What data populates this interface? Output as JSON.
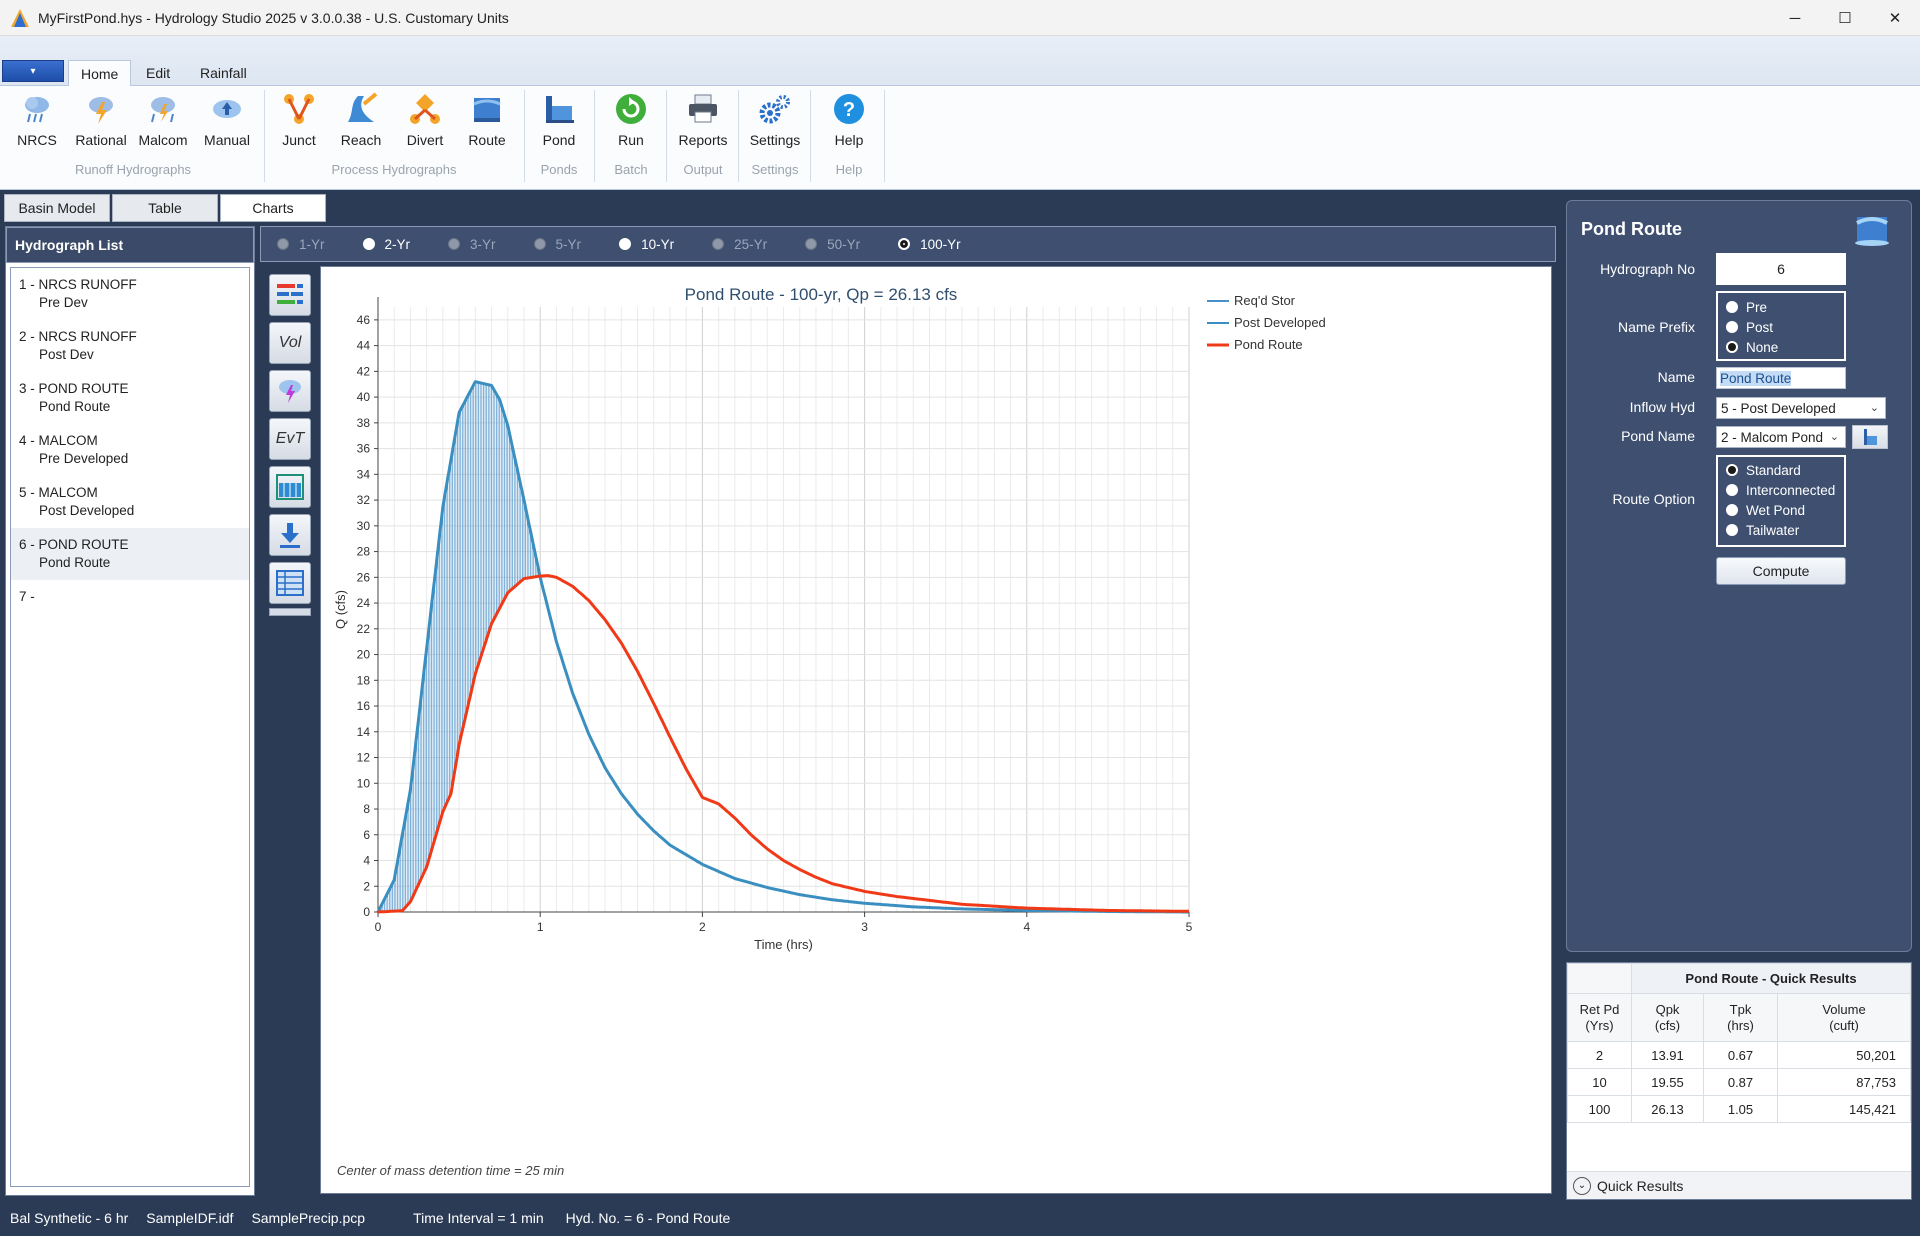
{
  "window": {
    "title": "MyFirstPond.hys - Hydrology Studio 2025 v 3.0.0.38 - U.S. Customary Units",
    "minimize": "─",
    "maximize": "☐",
    "close": "✕"
  },
  "ribbon": {
    "app_menu": "▾",
    "tabs": [
      {
        "label": "Home"
      },
      {
        "label": "Edit"
      },
      {
        "label": "Rainfall"
      }
    ],
    "buttons": [
      {
        "label": "NRCS",
        "icon": "cloud-rain-icon"
      },
      {
        "label": "Rational",
        "icon": "cloud-lightning-icon"
      },
      {
        "label": "Malcom",
        "icon": "cloud-storm-icon"
      },
      {
        "label": "Manual",
        "icon": "cloud-upload-icon"
      },
      {
        "label": "Junct",
        "icon": "junction-icon"
      },
      {
        "label": "Reach",
        "icon": "reach-icon"
      },
      {
        "label": "Divert",
        "icon": "divert-icon"
      },
      {
        "label": "Route",
        "icon": "route-icon"
      },
      {
        "label": "Pond",
        "icon": "pond-icon"
      },
      {
        "label": "Run",
        "icon": "run-icon"
      },
      {
        "label": "Reports",
        "icon": "printer-icon"
      },
      {
        "label": "Settings",
        "icon": "gears-icon"
      },
      {
        "label": "Help",
        "icon": "help-icon"
      }
    ],
    "groups": [
      "Runoff Hydrographs",
      "Process Hydrographs",
      "Ponds",
      "Batch",
      "Output",
      "Settings",
      "Help"
    ]
  },
  "view_tabs": [
    {
      "label": "Basin Model"
    },
    {
      "label": "Table"
    },
    {
      "label": "Charts"
    }
  ],
  "hydrograph_list": {
    "header": "Hydrograph List",
    "items": [
      {
        "title": "1 - NRCS RUNOFF",
        "sub": "Pre Dev"
      },
      {
        "title": "2 - NRCS RUNOFF",
        "sub": "Post Dev"
      },
      {
        "title": "3 - POND ROUTE",
        "sub": "Pond Route"
      },
      {
        "title": "4 - MALCOM",
        "sub": "Pre Developed"
      },
      {
        "title": "5 - MALCOM",
        "sub": "Post Developed"
      },
      {
        "title": "6 - POND ROUTE",
        "sub": "Pond Route"
      },
      {
        "title": "7 -",
        "sub": ""
      }
    ]
  },
  "frequencies": [
    "1-Yr",
    "2-Yr",
    "3-Yr",
    "5-Yr",
    "10-Yr",
    "25-Yr",
    "50-Yr",
    "100-Yr"
  ],
  "chart_tools": [
    {
      "label": "",
      "icon": "legend-icon"
    },
    {
      "label": "Vol",
      "icon": "volume-icon"
    },
    {
      "label": "",
      "icon": "storm-icon"
    },
    {
      "label": "EvT",
      "icon": "elevation-vs-time-icon"
    },
    {
      "label": "",
      "icon": "pond-view-icon"
    },
    {
      "label": "",
      "icon": "download-icon"
    },
    {
      "label": "",
      "icon": "grid-table-icon"
    }
  ],
  "chart_data": {
    "type": "line",
    "title": "Pond Route - 100-yr, Qp = 26.13 cfs",
    "xlabel": "Time (hrs)",
    "ylabel": "Q (cfs)",
    "xlim": [
      0,
      5
    ],
    "ylim": [
      0,
      47
    ],
    "xticks": [
      0,
      1,
      2,
      3,
      4,
      5
    ],
    "yticks": [
      0,
      2,
      4,
      6,
      8,
      10,
      12,
      14,
      16,
      18,
      20,
      22,
      24,
      26,
      28,
      30,
      32,
      34,
      36,
      38,
      40,
      42,
      44,
      46
    ],
    "grid": true,
    "legend_position": "right",
    "annotation": "Center of mass detention time = 25 min",
    "series": [
      {
        "name": "Req'd Stor",
        "color": "#4a90c8",
        "style": "hatch",
        "values": []
      },
      {
        "name": "Post Developed",
        "color": "#3a8fc0",
        "x": [
          0,
          0.1,
          0.2,
          0.3,
          0.4,
          0.5,
          0.6,
          0.7,
          0.75,
          0.8,
          0.9,
          1.0,
          1.1,
          1.2,
          1.3,
          1.4,
          1.5,
          1.6,
          1.7,
          1.8,
          2.0,
          2.2,
          2.4,
          2.6,
          2.8,
          3.0,
          3.3,
          3.6,
          4.0,
          4.5,
          5.0
        ],
        "y": [
          0,
          2.5,
          9.5,
          20.5,
          31.5,
          38.8,
          41.2,
          40.9,
          39.8,
          37.8,
          32.0,
          26.0,
          21.0,
          17.0,
          13.8,
          11.2,
          9.2,
          7.6,
          6.3,
          5.2,
          3.7,
          2.6,
          1.9,
          1.35,
          0.95,
          0.68,
          0.4,
          0.24,
          0.12,
          0.04,
          0.0
        ]
      },
      {
        "name": "Pond Route",
        "color": "#f03a17",
        "x": [
          0,
          0.15,
          0.2,
          0.3,
          0.4,
          0.45,
          0.5,
          0.6,
          0.7,
          0.8,
          0.9,
          1.0,
          1.05,
          1.1,
          1.2,
          1.3,
          1.4,
          1.5,
          1.6,
          1.7,
          1.8,
          1.9,
          2.0,
          2.1,
          2.2,
          2.3,
          2.4,
          2.5,
          2.6,
          2.7,
          2.8,
          3.0,
          3.2,
          3.4,
          3.6,
          3.8,
          4.0,
          4.5,
          5.0
        ],
        "y": [
          0,
          0.1,
          0.8,
          3.5,
          7.8,
          9.2,
          13.0,
          18.5,
          22.4,
          24.8,
          25.9,
          26.1,
          26.13,
          26.0,
          25.3,
          24.2,
          22.7,
          20.9,
          18.7,
          16.2,
          13.6,
          11.1,
          8.9,
          8.4,
          7.3,
          6.0,
          4.9,
          4.0,
          3.3,
          2.7,
          2.2,
          1.6,
          1.2,
          0.9,
          0.6,
          0.45,
          0.3,
          0.12,
          0.05
        ]
      }
    ]
  },
  "route_panel": {
    "title": "Pond Route",
    "hyd_no_label": "Hydrograph No",
    "hyd_no": "6",
    "prefix_label": "Name Prefix",
    "prefix_options": [
      "Pre",
      "Post",
      "None"
    ],
    "prefix_selected": "None",
    "name_label": "Name",
    "name": "Pond Route",
    "inflow_label": "Inflow Hyd",
    "inflow": "5 - Post Developed",
    "pond_label": "Pond Name",
    "pond": "2 - Malcom Pond",
    "route_label": "Route Option",
    "route_options": [
      "Standard",
      "Interconnected",
      "Wet Pond",
      "Tailwater"
    ],
    "route_selected": "Standard",
    "compute": "Compute"
  },
  "quick_results": {
    "title": "Pond Route - Quick Results",
    "headers": [
      [
        "Ret Pd",
        "(Yrs)"
      ],
      [
        "Qpk",
        "(cfs)"
      ],
      [
        "Tpk",
        "(hrs)"
      ],
      [
        "Volume",
        "(cuft)"
      ]
    ],
    "rows": [
      [
        "2",
        "13.91",
        "0.67",
        "50,201"
      ],
      [
        "10",
        "19.55",
        "0.87",
        "87,753"
      ],
      [
        "100",
        "26.13",
        "1.05",
        "145,421"
      ]
    ],
    "footer": "Quick Results"
  },
  "status": [
    "Bal Synthetic - 6 hr",
    "SampleIDF.idf",
    "SamplePrecip.pcp",
    "Time Interval = 1 min",
    "Hyd. No. = 6 - Pond Route"
  ]
}
